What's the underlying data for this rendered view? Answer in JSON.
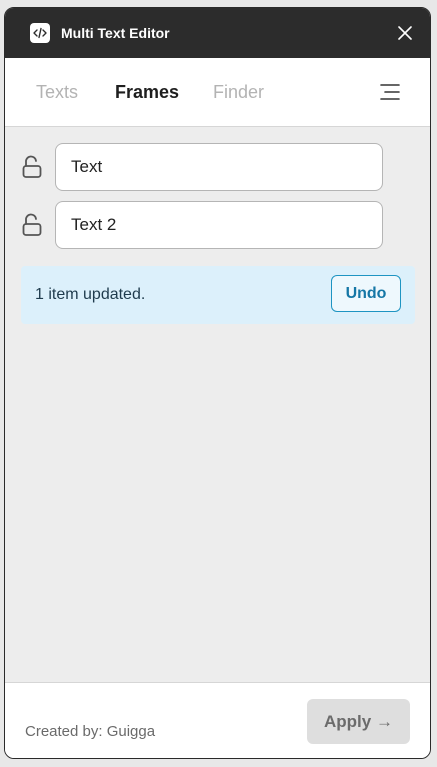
{
  "window": {
    "title": "Multi Text Editor"
  },
  "tabs": [
    {
      "label": "Texts",
      "active": false
    },
    {
      "label": "Frames",
      "active": true
    },
    {
      "label": "Finder",
      "active": false
    }
  ],
  "rows": [
    {
      "value": "Text",
      "lock_state": "unlocked"
    },
    {
      "value": "Text 2",
      "lock_state": "unlocked"
    }
  ],
  "notice": {
    "message": "1 item updated.",
    "undo_label": "Undo"
  },
  "footer": {
    "credit": "Created by: Guigga",
    "apply_label": "Apply →"
  },
  "colors": {
    "titlebar": "#2c2c2c",
    "notice_bg": "#dcf0fb",
    "accent": "#1e94c2",
    "apply_bg": "#dedede"
  },
  "icons": {
    "app": "code-icon",
    "close": "close-icon",
    "menu": "menu-icon",
    "lock": "unlock-icon"
  }
}
